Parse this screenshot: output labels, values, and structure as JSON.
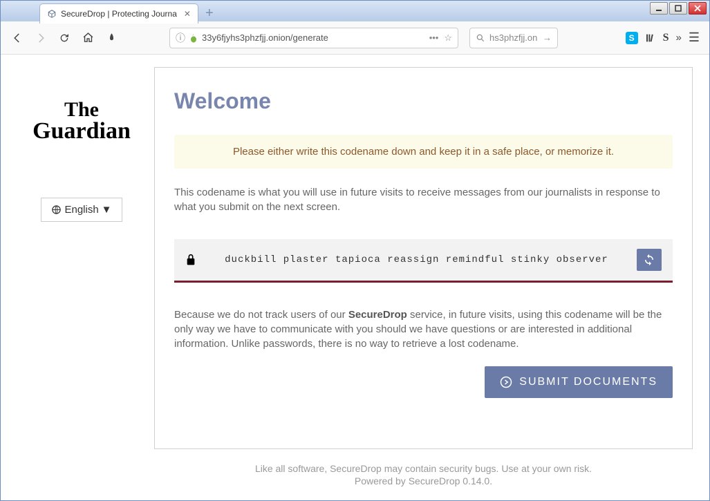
{
  "window": {
    "tab_title": "SecureDrop | Protecting Journa"
  },
  "toolbar": {
    "url": "33y6fjyhs3phzfjj.onion/generate",
    "search": "hs3phzfjj.on"
  },
  "sidebar": {
    "logo_line1": "The",
    "logo_line2": "Guardian",
    "language": "English"
  },
  "main": {
    "heading": "Welcome",
    "notice": "Please either write this codename down and keep it in a safe place, or memorize it.",
    "desc1": "This codename is what you will use in future visits to receive messages from our journalists in response to what you submit on the next screen.",
    "codename": "duckbill plaster tapioca reassign remindful stinky observer",
    "desc2_pre": "Because we do not track users of our ",
    "desc2_bold": "SecureDrop",
    "desc2_post": " service, in future visits, using this codename will be the only way we have to communicate with you should we have questions or are interested in additional information. Unlike passwords, there is no way to retrieve a lost codename.",
    "submit": "SUBMIT DOCUMENTS"
  },
  "footer": {
    "line1": "Like all software, SecureDrop may contain security bugs. Use at your own risk.",
    "line2": "Powered by SecureDrop 0.14.0."
  }
}
